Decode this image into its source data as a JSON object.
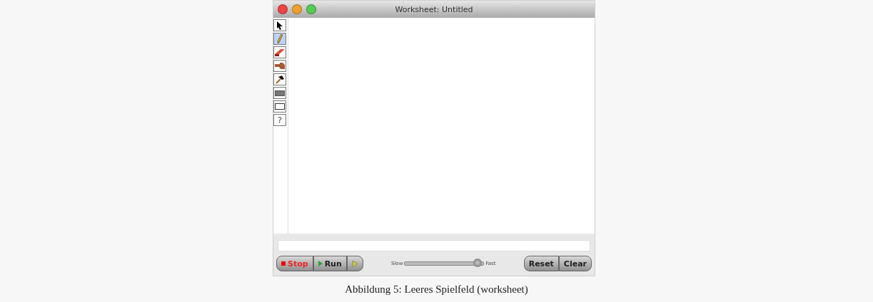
{
  "window": {
    "title": "Worksheet: Untitled"
  },
  "tools": [
    {
      "kind": "pointer",
      "selected": false
    },
    {
      "kind": "pencil",
      "selected": true
    },
    {
      "kind": "eraser",
      "selected": false
    },
    {
      "kind": "hand",
      "selected": false
    },
    {
      "kind": "hammer",
      "selected": false
    },
    {
      "kind": "filled-box",
      "selected": false
    },
    {
      "kind": "empty-box",
      "selected": false
    },
    {
      "kind": "help",
      "label": "?",
      "selected": false
    }
  ],
  "controls": {
    "stop": "Stop",
    "run": "Run",
    "slow": "Slow",
    "fast": "Fast",
    "speed": {
      "level": 0.92
    },
    "reset": "Reset",
    "clear": "Clear"
  },
  "caption": "Abbildung 5: Leeres Spielfeld (worksheet)"
}
